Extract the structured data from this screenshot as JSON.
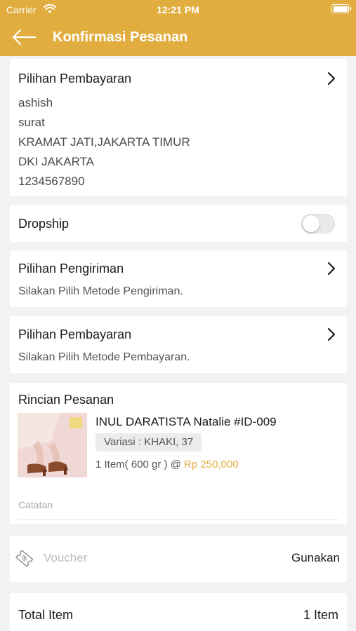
{
  "status_bar": {
    "carrier": "Carrier",
    "time": "12:21 PM"
  },
  "header": {
    "title": "Konfirmasi Pesanan"
  },
  "address_card": {
    "title": "Pilihan Pembayaran",
    "lines": [
      "ashish",
      "surat",
      "KRAMAT JATI,JAKARTA TIMUR",
      "DKI JAKARTA",
      "1234567890"
    ]
  },
  "dropship": {
    "label": "Dropship",
    "enabled": false
  },
  "shipping": {
    "title": "Pilihan Pengiriman",
    "subtitle": "Silakan Pilih Metode Pengiriman."
  },
  "payment": {
    "title": "Pilihan Pembayaran",
    "subtitle": "Silakan Pilih Metode Pembayaran."
  },
  "order_detail": {
    "title": "Rincian Pesanan",
    "product": {
      "name": "INUL DARATISTA Natalie #ID-009",
      "variant": "Variasi : KHAKI, 37",
      "qty_text": "1 Item( 600 gr ) @",
      "price": "Rp 250,000"
    },
    "note_placeholder": "Catatan"
  },
  "voucher": {
    "placeholder": "Voucher",
    "apply_label": "Gunakan"
  },
  "summary": {
    "total_item_label": "Total Item",
    "total_item_value": "1 Item"
  },
  "colors": {
    "accent": "#e2ad3f",
    "background": "#f2f2f2",
    "card": "#ffffff"
  },
  "icons": [
    "wifi-icon",
    "battery-icon",
    "back-arrow-icon",
    "chevron-right-icon",
    "voucher-icon"
  ]
}
